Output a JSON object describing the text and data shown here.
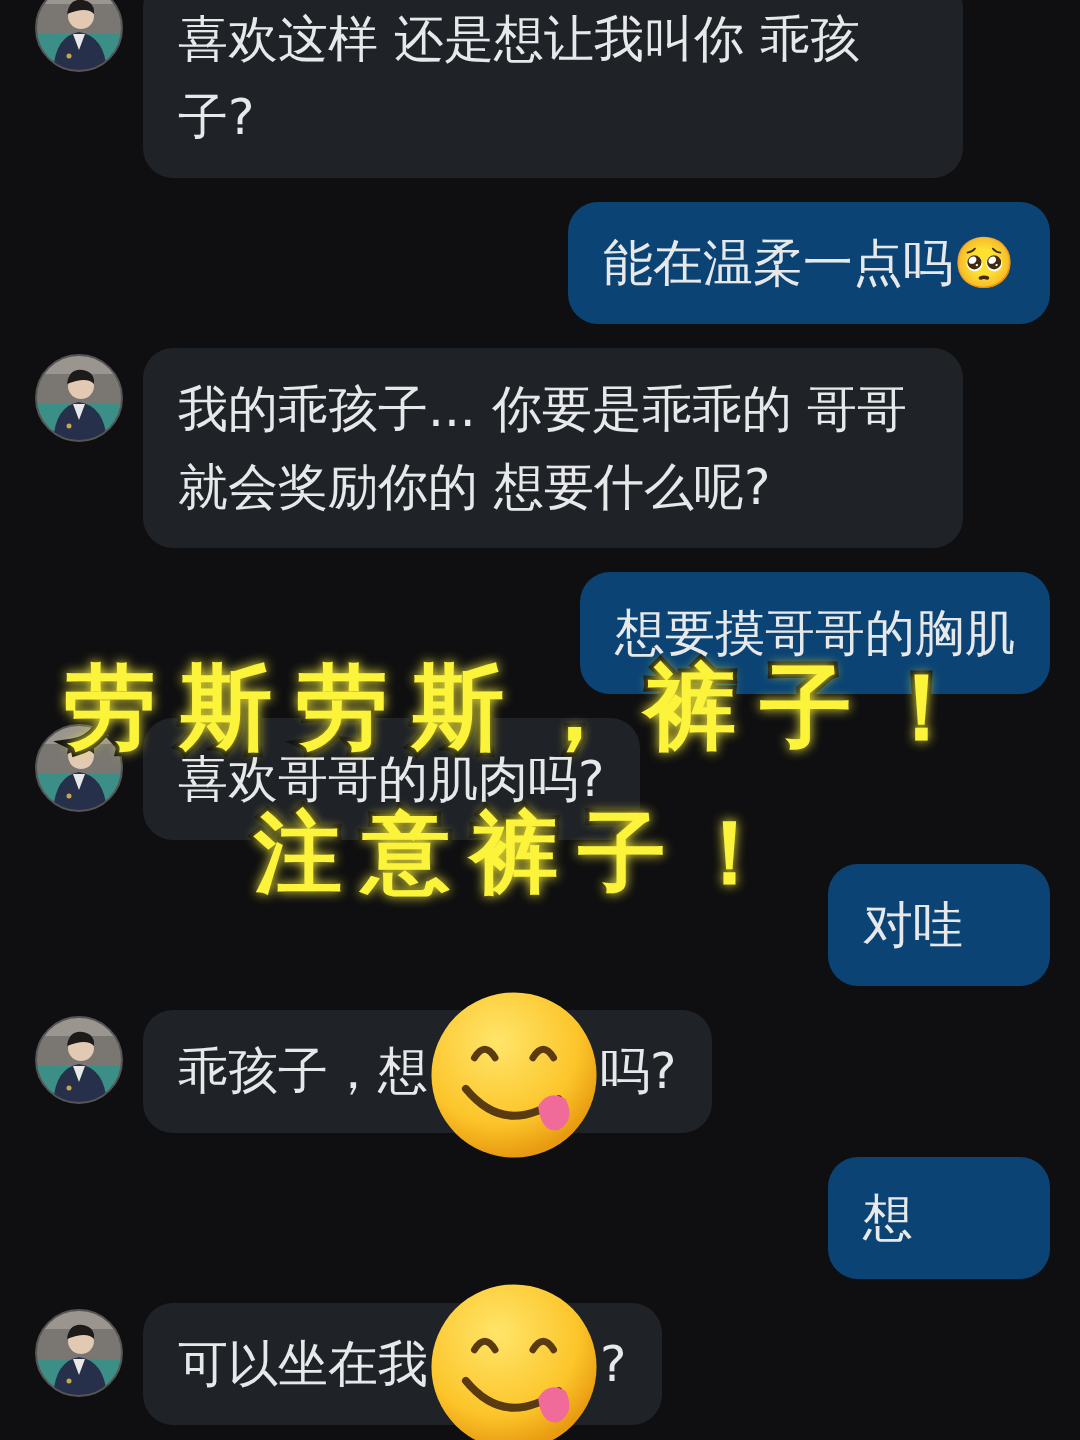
{
  "messages": [
    {
      "outgoing": false,
      "kind": "text",
      "text": "喜欢这样 还是想让我叫你 乖孩子?"
    },
    {
      "outgoing": true,
      "kind": "text",
      "text": "能在温柔一点吗🥺"
    },
    {
      "outgoing": false,
      "kind": "text",
      "text": "我的乖孩子... 你要是乖乖的 哥哥就会奖励你的 想要什么呢?"
    },
    {
      "outgoing": true,
      "kind": "text",
      "text": "想要摸哥哥的胸肌"
    },
    {
      "outgoing": false,
      "kind": "text",
      "text": "喜欢哥哥的肌肉吗?"
    },
    {
      "outgoing": true,
      "kind": "text",
      "text": "对哇"
    },
    {
      "outgoing": false,
      "kind": "stickered",
      "before": "乖孩子，想",
      "after": "吗?"
    },
    {
      "outgoing": true,
      "kind": "text",
      "text": "想"
    },
    {
      "outgoing": false,
      "kind": "stickered",
      "before": "可以坐在我",
      "after": "?"
    }
  ],
  "caption": {
    "lines": [
      "劳斯劳斯，裤子！",
      "注意裤子！"
    ]
  }
}
